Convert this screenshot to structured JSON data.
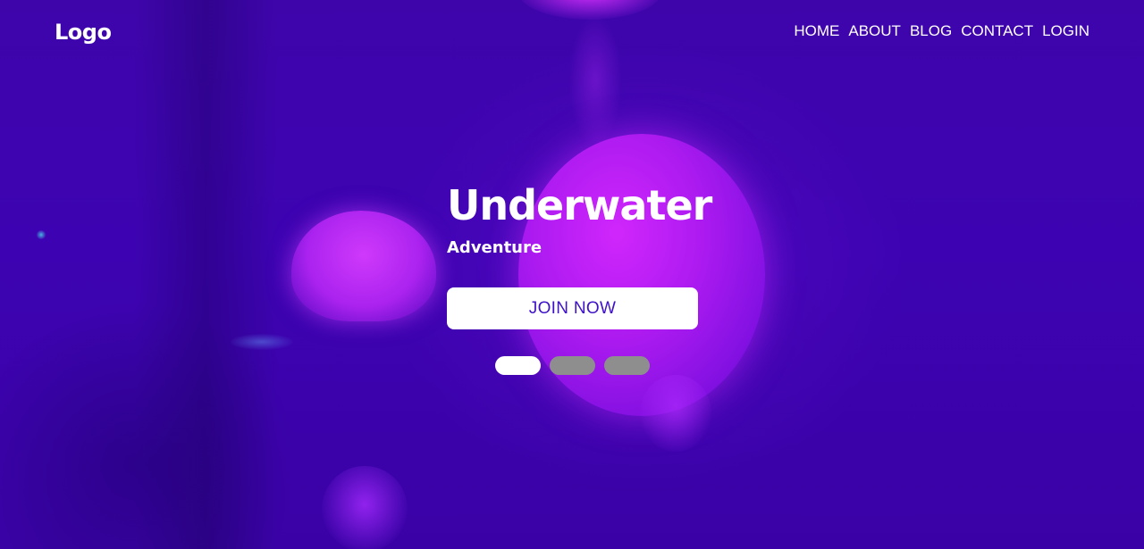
{
  "header": {
    "logo": "Logo",
    "nav": [
      {
        "label": "HOME"
      },
      {
        "label": "ABOUT"
      },
      {
        "label": "BLOG"
      },
      {
        "label": "CONTACT"
      },
      {
        "label": "LOGIN"
      }
    ]
  },
  "hero": {
    "title": "Underwater",
    "subtitle": "Adventure",
    "cta_label": "JOIN NOW",
    "slides_total": 3,
    "active_slide": 1
  },
  "colors": {
    "background": "#3f04b0",
    "jellyfish": "#d228ff",
    "button_text": "#3e12c8",
    "dot_inactive": "#8e8e8e",
    "dot_active": "#ffffff"
  }
}
